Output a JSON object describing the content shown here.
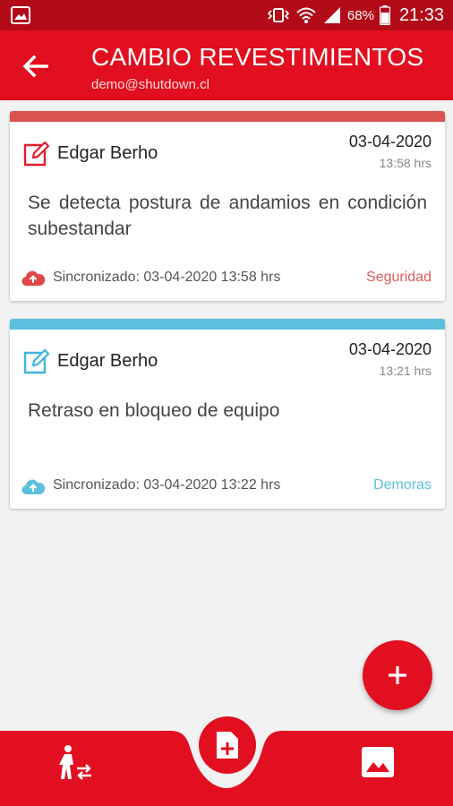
{
  "status_bar": {
    "battery_percent": "68%",
    "time": "21:33",
    "icons": [
      "image-icon",
      "vibrate-icon",
      "wifi-icon",
      "signal-icon",
      "battery-icon"
    ]
  },
  "header": {
    "title": "CAMBIO REVESTIMIENTOS",
    "subtitle": "demo@shutdown.cl",
    "back_icon": "arrow-left-icon",
    "color": "#e10f1f"
  },
  "cards": [
    {
      "accent_color": "#d9534f",
      "author": "Edgar Berho",
      "date": "03-04-2020",
      "time": "13:58 hrs",
      "text": "Se detecta postura de andamios en condición subestandar",
      "sync_text": "Sincronizado: 03-04-2020 13:58 hrs",
      "category": "Seguridad",
      "category_color": "#e05a5a",
      "icon_color": "#e01e2e"
    },
    {
      "accent_color": "#5bc0de",
      "author": "Edgar Berho",
      "date": "03-04-2020",
      "time": "13:21 hrs",
      "text": "Retraso en bloqueo de equipo",
      "sync_text": "Sincronizado: 03-04-2020 13:22 hrs",
      "category": "Demoras",
      "category_color": "#5bc0de",
      "icon_color": "#3fb6dc"
    }
  ],
  "fab": {
    "icon": "plus-icon"
  },
  "bottom_nav": {
    "left_icon": "person-exchange-icon",
    "center_icon": "add-document-icon",
    "right_icon": "image-icon"
  }
}
